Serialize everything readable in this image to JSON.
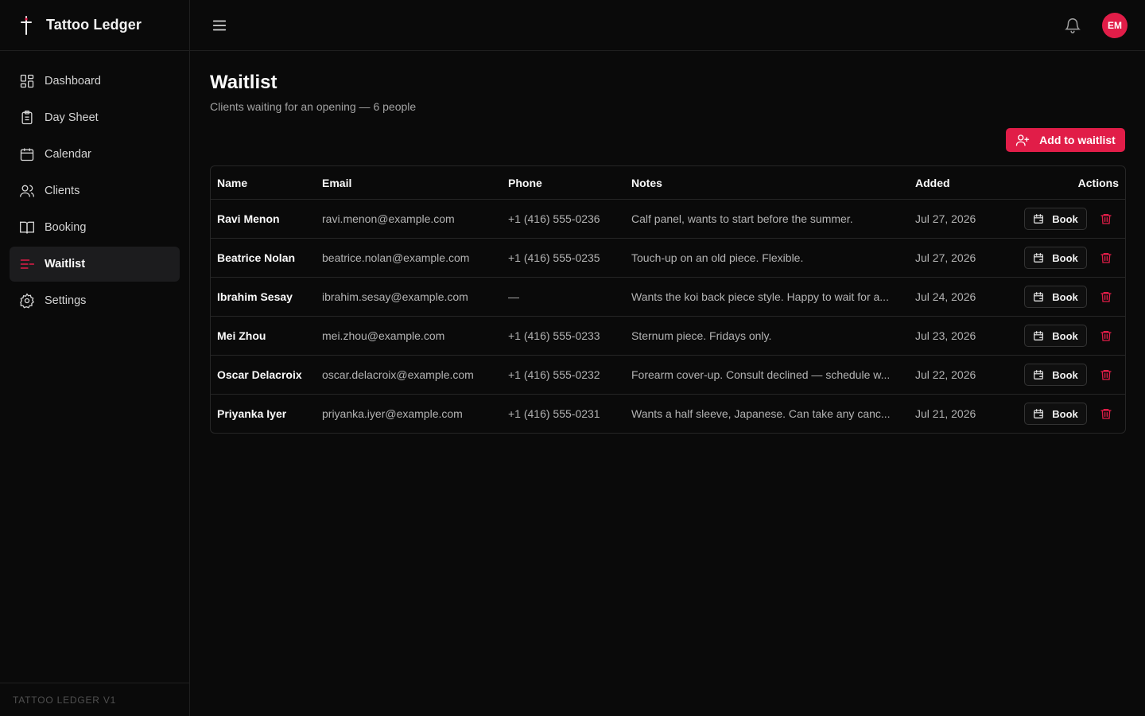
{
  "app": {
    "name": "Tattoo Ledger",
    "version": "TATTOO LEDGER V1"
  },
  "sidebar": {
    "items": [
      {
        "label": "Dashboard",
        "icon": "dashboard-icon",
        "active": false
      },
      {
        "label": "Day Sheet",
        "icon": "clipboard-icon",
        "active": false
      },
      {
        "label": "Calendar",
        "icon": "calendar-icon",
        "active": false
      },
      {
        "label": "Clients",
        "icon": "users-icon",
        "active": false
      },
      {
        "label": "Booking",
        "icon": "book-icon",
        "active": false
      },
      {
        "label": "Waitlist",
        "icon": "list-minus-icon",
        "active": true
      },
      {
        "label": "Settings",
        "icon": "gear-icon",
        "active": false
      }
    ]
  },
  "topbar": {
    "avatar_initials": "EM"
  },
  "page": {
    "title": "Waitlist",
    "subtitle": "Clients waiting for an opening — 6 people",
    "add_button": "Add to waitlist"
  },
  "table": {
    "headers": {
      "name": "Name",
      "email": "Email",
      "phone": "Phone",
      "notes": "Notes",
      "added": "Added",
      "actions": "Actions"
    },
    "book_label": "Book",
    "rows": [
      {
        "name": "Ravi Menon",
        "email": "ravi.menon@example.com",
        "phone": "+1 (416) 555-0236",
        "notes": "Calf panel, wants to start before the summer.",
        "added": "Jul 27, 2026"
      },
      {
        "name": "Beatrice Nolan",
        "email": "beatrice.nolan@example.com",
        "phone": "+1 (416) 555-0235",
        "notes": "Touch-up on an old piece. Flexible.",
        "added": "Jul 27, 2026"
      },
      {
        "name": "Ibrahim Sesay",
        "email": "ibrahim.sesay@example.com",
        "phone": "—",
        "notes": "Wants the koi back piece style. Happy to wait for a...",
        "added": "Jul 24, 2026"
      },
      {
        "name": "Mei Zhou",
        "email": "mei.zhou@example.com",
        "phone": "+1 (416) 555-0233",
        "notes": "Sternum piece. Fridays only.",
        "added": "Jul 23, 2026"
      },
      {
        "name": "Oscar Delacroix",
        "email": "oscar.delacroix@example.com",
        "phone": "+1 (416) 555-0232",
        "notes": "Forearm cover-up. Consult declined — schedule w...",
        "added": "Jul 22, 2026"
      },
      {
        "name": "Priyanka Iyer",
        "email": "priyanka.iyer@example.com",
        "phone": "+1 (416) 555-0231",
        "notes": "Wants a half sleeve, Japanese. Can take any canc...",
        "added": "Jul 21, 2026"
      }
    ]
  },
  "colors": {
    "accent": "#e11d48",
    "background": "#0a0a0a",
    "border": "#262626"
  }
}
